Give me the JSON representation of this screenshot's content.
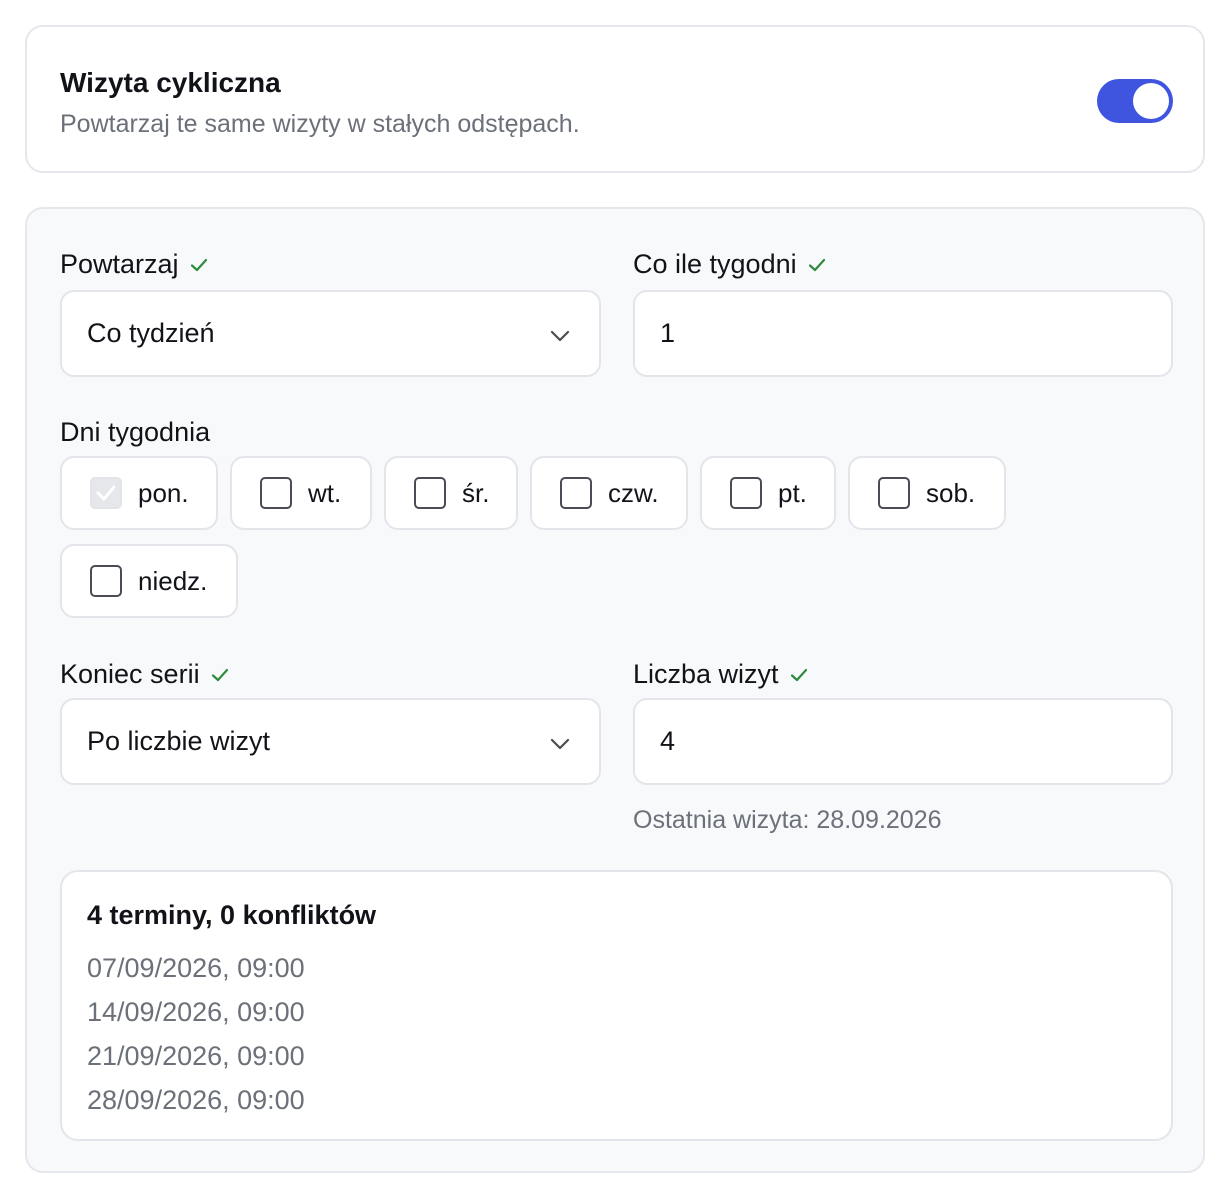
{
  "recurring": {
    "title": "Wizyta cykliczna",
    "subtitle": "Powtarzaj te same wizyty w stałych odstępach.",
    "toggle_on": true
  },
  "repeat": {
    "label": "Powtarzaj",
    "value": "Co tydzień"
  },
  "interval": {
    "label": "Co ile tygodni",
    "value": "1"
  },
  "weekdays": {
    "label": "Dni tygodnia",
    "days": [
      {
        "label": "pon.",
        "checked": true,
        "disabled": true
      },
      {
        "label": "wt.",
        "checked": false
      },
      {
        "label": "śr.",
        "checked": false
      },
      {
        "label": "czw.",
        "checked": false
      },
      {
        "label": "pt.",
        "checked": false
      },
      {
        "label": "sob.",
        "checked": false
      },
      {
        "label": "niedz.",
        "checked": false
      }
    ]
  },
  "series_end": {
    "label": "Koniec serii",
    "value": "Po liczbie wizyt"
  },
  "visit_count": {
    "label": "Liczba wizyt",
    "value": "4",
    "hint": "Ostatnia wizyta: 28.09.2026"
  },
  "summary": {
    "heading": "4 terminy, 0 konfliktów",
    "dates": [
      "07/09/2026, 09:00",
      "14/09/2026, 09:00",
      "21/09/2026, 09:00",
      "28/09/2026, 09:00"
    ]
  },
  "colors": {
    "accent": "#3f55e0",
    "valid_check": "#2e8b3e"
  }
}
